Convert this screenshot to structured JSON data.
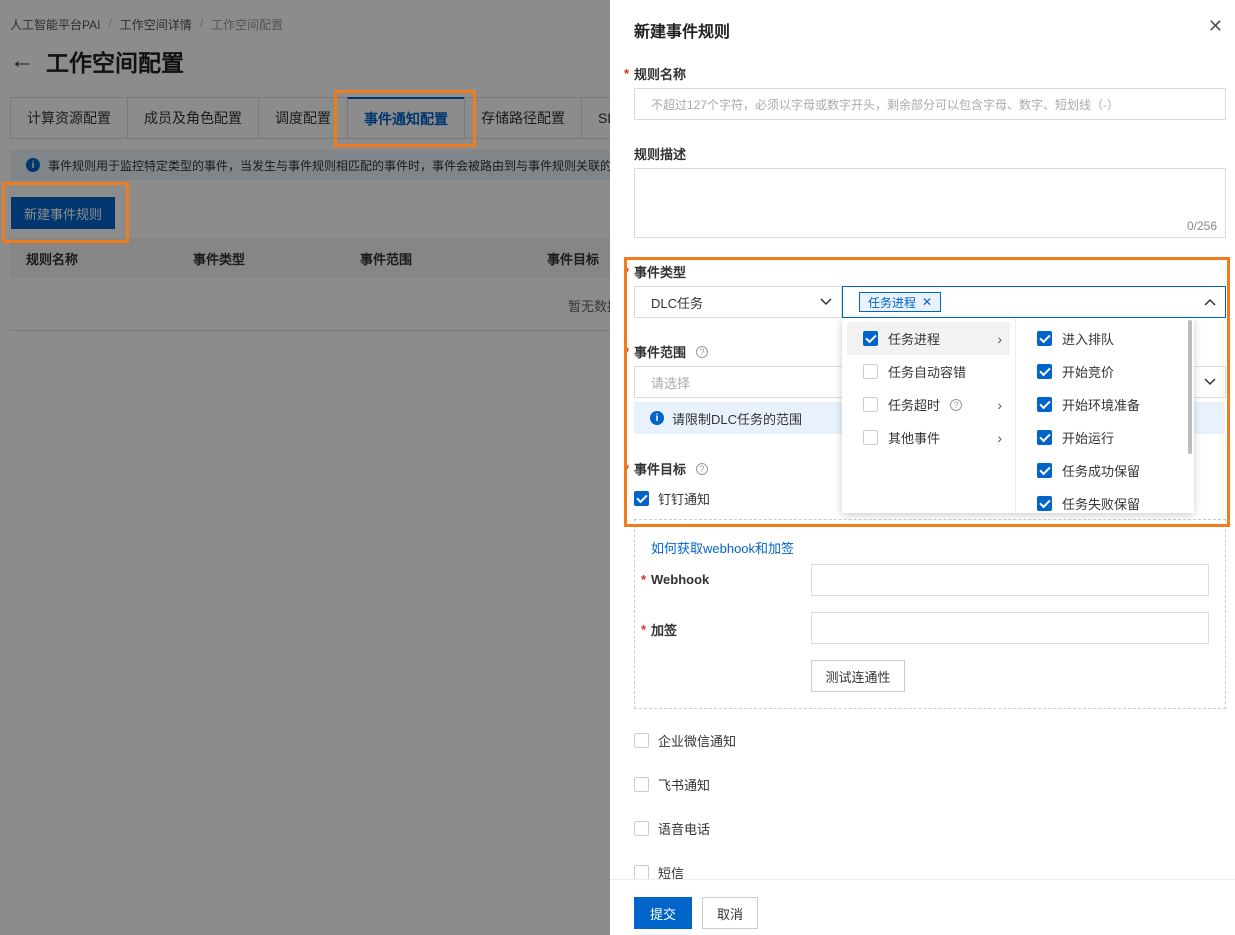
{
  "breadcrumb": [
    "人工智能平台PAI",
    "工作空间详情",
    "工作空间配置"
  ],
  "page_title": "工作空间配置",
  "tabs": [
    "计算资源配置",
    "成员及角色配置",
    "调度配置",
    "事件通知配置",
    "存储路径配置",
    "SL"
  ],
  "active_tab": "事件通知配置",
  "info_text": "事件规则用于监控特定类型的事件，当发生与事件规则相匹配的事件时，事件会被路由到与事件规则关联的",
  "new_rule_button": "新建事件规则",
  "table": {
    "columns": [
      "规则名称",
      "事件类型",
      "事件范围",
      "事件目标"
    ],
    "empty_text": "暂无数据"
  },
  "drawer": {
    "title": "新建事件规则",
    "rule_name": {
      "label": "规则名称",
      "placeholder": "不超过127个字符，必须以字母或数字开头，剩余部分可以包含字母、数字、短划线（-）"
    },
    "rule_desc": {
      "label": "规则描述",
      "count": "0/256"
    },
    "event_type": {
      "label": "事件类型",
      "source": "DLC任务",
      "tags": [
        "任务进程"
      ]
    },
    "event_scope": {
      "label": "事件范围",
      "placeholder": "请选择",
      "note": "请限制DLC任务的范围"
    },
    "event_target": {
      "label": "事件目标"
    },
    "cascade": {
      "level1": [
        {
          "label": "任务进程",
          "checked": true,
          "has_children": true,
          "selected": true
        },
        {
          "label": "任务自动容错",
          "checked": false,
          "has_children": false
        },
        {
          "label": "任务超时",
          "checked": false,
          "has_children": true,
          "help": true
        },
        {
          "label": "其他事件",
          "checked": false,
          "has_children": true
        }
      ],
      "level2": [
        {
          "label": "进入排队",
          "checked": true
        },
        {
          "label": "开始竞价",
          "checked": true
        },
        {
          "label": "开始环境准备",
          "checked": true
        },
        {
          "label": "开始运行",
          "checked": true
        },
        {
          "label": "任务成功保留",
          "checked": true
        },
        {
          "label": "任务失败保留",
          "checked": true
        }
      ]
    },
    "targets": {
      "dingtalk": {
        "label": "钉钉通知",
        "checked": true
      },
      "webhook_link": "如何获取webhook和加签",
      "webhook_label": "Webhook",
      "sign_label": "加签",
      "test_button": "测试连通性",
      "others": [
        {
          "label": "企业微信通知",
          "checked": false
        },
        {
          "label": "飞书通知",
          "checked": false
        },
        {
          "label": "语音电话",
          "checked": false
        },
        {
          "label": "短信",
          "checked": false
        }
      ]
    },
    "submit": "提交",
    "cancel": "取消"
  },
  "colors": {
    "primary": "#0064c8",
    "highlight": "#f07c1e",
    "required": "#d93026"
  }
}
